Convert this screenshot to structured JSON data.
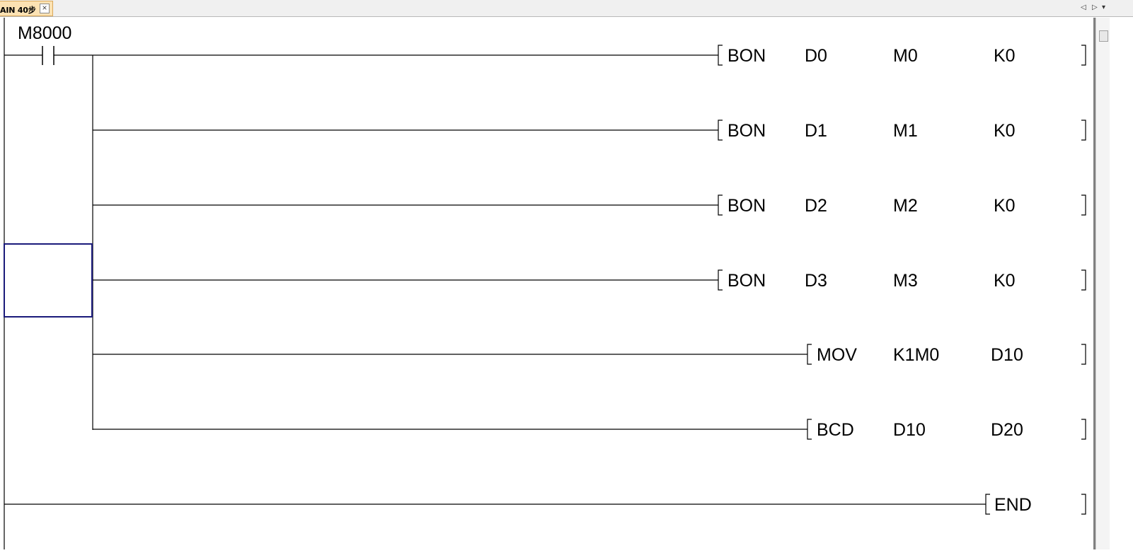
{
  "tab": {
    "label": "AIN 40步",
    "close_glyph": "×"
  },
  "nav": {
    "left_glyph": "◁",
    "right_glyph": "▷",
    "menu_glyph": "▾"
  },
  "ladder": {
    "contact": "M8000",
    "rungs": [
      {
        "instr": "BON",
        "ops": [
          "D0",
          "M0",
          "K0"
        ]
      },
      {
        "instr": "BON",
        "ops": [
          "D1",
          "M1",
          "K0"
        ]
      },
      {
        "instr": "BON",
        "ops": [
          "D2",
          "M2",
          "K0"
        ]
      },
      {
        "instr": "BON",
        "ops": [
          "D3",
          "M3",
          "K0"
        ]
      },
      {
        "instr": "MOV",
        "ops": [
          "K1M0",
          "D10"
        ]
      },
      {
        "instr": "BCD",
        "ops": [
          "D10",
          "D20"
        ]
      }
    ],
    "end": "END"
  }
}
